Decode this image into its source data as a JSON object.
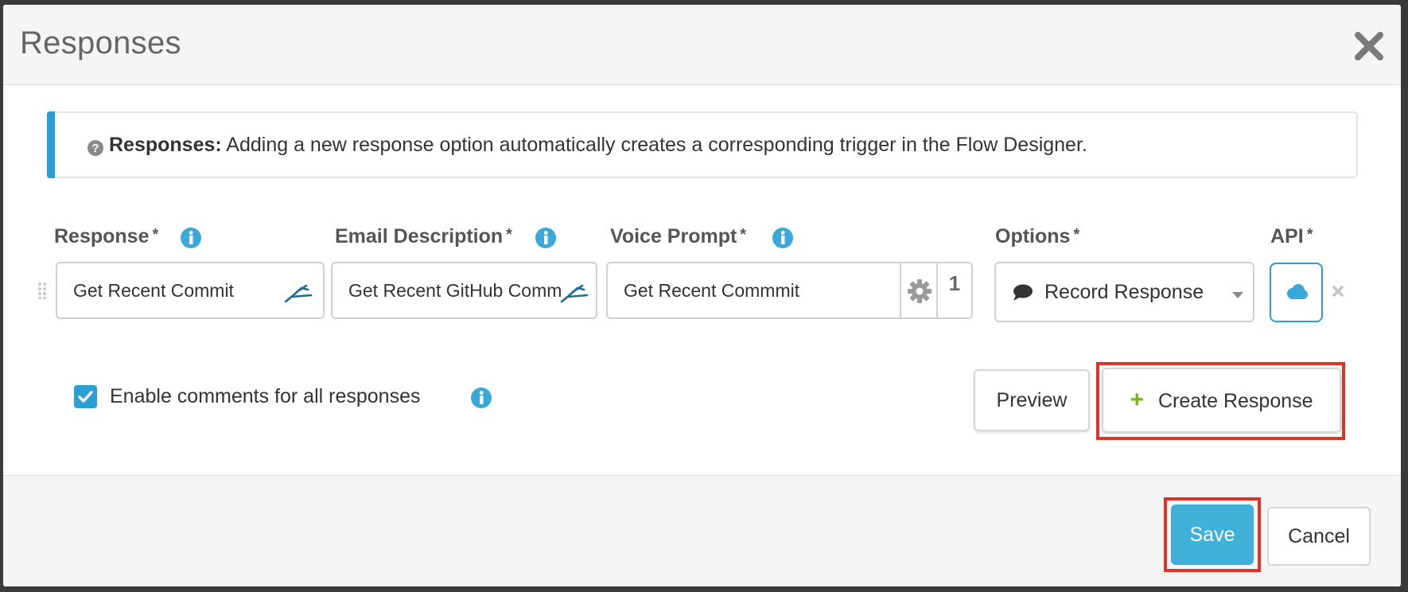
{
  "dialog": {
    "title": "Responses",
    "close_icon": "close-icon"
  },
  "banner": {
    "label": "Responses:",
    "text": "Adding a new response option automatically creates a corresponding trigger in the Flow Designer.",
    "icon": "question-circle-icon"
  },
  "fields": {
    "response": {
      "label": "Response",
      "required": "*",
      "value": "Get Recent Commit"
    },
    "email_description": {
      "label": "Email Description",
      "required": "*",
      "value": "Get Recent GitHub Comm"
    },
    "voice_prompt": {
      "label": "Voice Prompt",
      "required": "*",
      "value": "Get Recent Commmit",
      "count": "1"
    },
    "options": {
      "label": "Options",
      "required": "*",
      "selected": "Record Response"
    },
    "api": {
      "label": "API",
      "required": "*"
    }
  },
  "comments": {
    "label": "Enable comments for all responses",
    "checked": true
  },
  "buttons": {
    "preview": "Preview",
    "create_response": "Create Response",
    "create_plus": "+",
    "save": "Save",
    "cancel": "Cancel"
  },
  "colors": {
    "accent": "#2a9fd6",
    "save_bg": "#3fb0d8",
    "highlight": "#e53025",
    "plus_green": "#7cb518"
  }
}
